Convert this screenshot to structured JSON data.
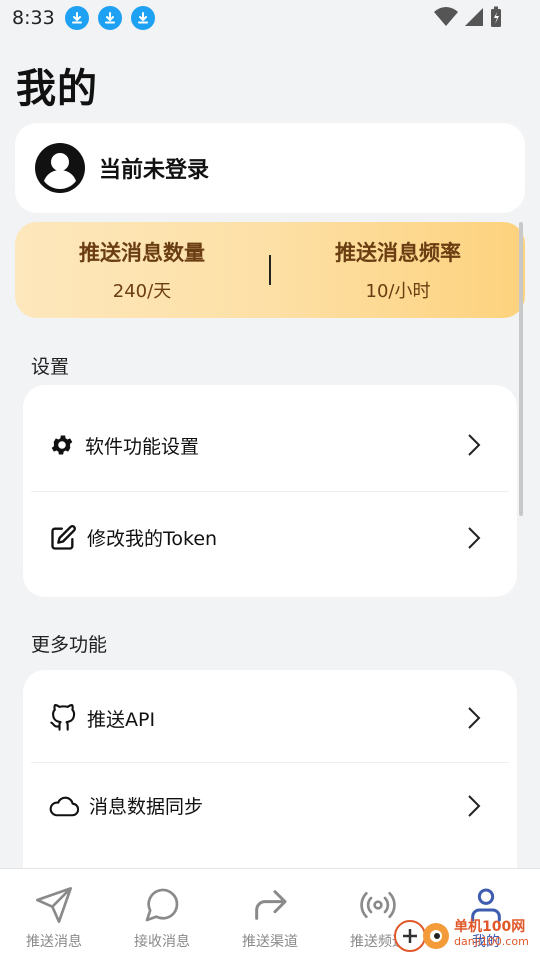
{
  "status_bar": {
    "time": "8:33"
  },
  "page_title": "我的",
  "login": {
    "text": "当前未登录"
  },
  "stats": [
    {
      "label": "推送消息数量",
      "value": "240/天"
    },
    {
      "label": "推送消息频率",
      "value": "10/小时"
    }
  ],
  "settings": {
    "section_label": "设置",
    "items": [
      {
        "label": "软件功能设置",
        "icon": "gear-icon"
      },
      {
        "label": "修改我的Token",
        "icon": "edit-icon"
      }
    ]
  },
  "more": {
    "section_label": "更多功能",
    "items": [
      {
        "label": "推送API",
        "icon": "github-icon"
      },
      {
        "label": "消息数据同步",
        "icon": "cloud-icon"
      }
    ]
  },
  "nav": [
    {
      "label": "推送消息",
      "icon": "send-icon"
    },
    {
      "label": "接收消息",
      "icon": "chat-icon"
    },
    {
      "label": "推送渠道",
      "icon": "share-arrow-icon"
    },
    {
      "label": "推送频道",
      "icon": "broadcast-icon"
    },
    {
      "label": "我的",
      "icon": "user-icon",
      "active": true
    }
  ],
  "watermark": {
    "title": "单机100网",
    "url": "danji100.com"
  },
  "colors": {
    "accent": "#3e5db0",
    "stats_text": "#6b3d12",
    "download_badge": "#1ea1f2"
  }
}
